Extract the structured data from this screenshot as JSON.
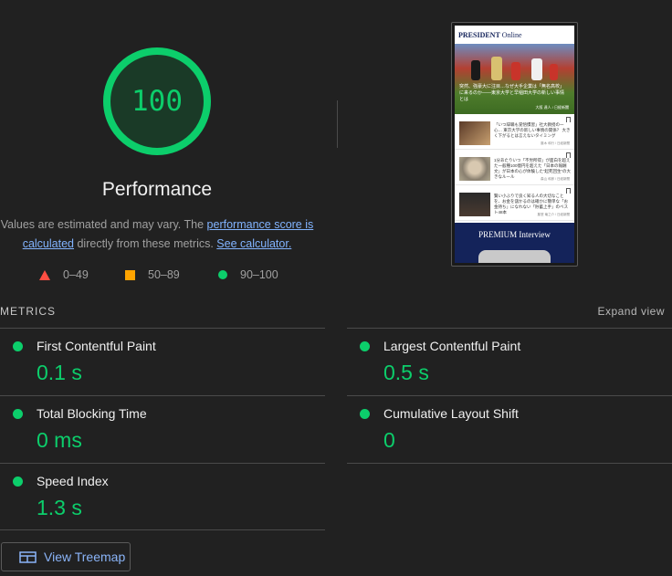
{
  "gauge": {
    "score": "100",
    "score_fraction": 1.0,
    "title": "Performance",
    "color": "#0cce6b"
  },
  "description": {
    "text_before": "Values are estimated and may vary. The ",
    "link_score": "performance score is calculated",
    "text_middle": " directly from these metrics. ",
    "link_calculator": "See calculator."
  },
  "legend": [
    {
      "shape": "triangle",
      "range": "0–49",
      "color": "#ff4e42"
    },
    {
      "shape": "square",
      "range": "50–89",
      "color": "#ffa400"
    },
    {
      "shape": "circle",
      "range": "90–100",
      "color": "#0cce6b"
    }
  ],
  "screenshot": {
    "logo_bold": "PRESIDENT",
    "logo_light": " Online",
    "hero_text": "突然、強豪大に注目…なぜ大手企業は「無名高校」に来るのか――東京大学と早稲田大学の新しい事情とは",
    "hero_meta": "大阪 達人 / 日経新聞",
    "articles": [
      {
        "text": "「いつ辞職も覚悟慣習」社大教授の一心… 東京大学の新しい事情の関係？ 大きく下がるとは言えないタイミング",
        "meta": "藤木 和行 / 日経新聞"
      },
      {
        "text": "1分あたりいつ「不労所得」が面白を超えた一般種100億円を超えた「日本の報酬文」が日本の心が体験した“起死回生”の大きなルール",
        "meta": "森山 和彦 / 日経新聞"
      },
      {
        "text": "賢い小ぶりで良く知る人の大切なことを、お金を儲かるのは確かに簡単な「お金持ち」になれない「貯蓄上手」のベスト48本",
        "meta": "藤堂 竜之介 / 日経新聞"
      }
    ],
    "premium_label": "PREMIUM Interview"
  },
  "metrics": {
    "title": "METRICS",
    "expand_label": "Expand view",
    "items": [
      {
        "label": "First Contentful Paint",
        "value": "0.1 s"
      },
      {
        "label": "Largest Contentful Paint",
        "value": "0.5 s"
      },
      {
        "label": "Total Blocking Time",
        "value": "0 ms"
      },
      {
        "label": "Cumulative Layout Shift",
        "value": "0"
      },
      {
        "label": "Speed Index",
        "value": "1.3 s"
      }
    ]
  },
  "treemap_button": {
    "label": "View Treemap",
    "icon": "treemap-icon"
  }
}
